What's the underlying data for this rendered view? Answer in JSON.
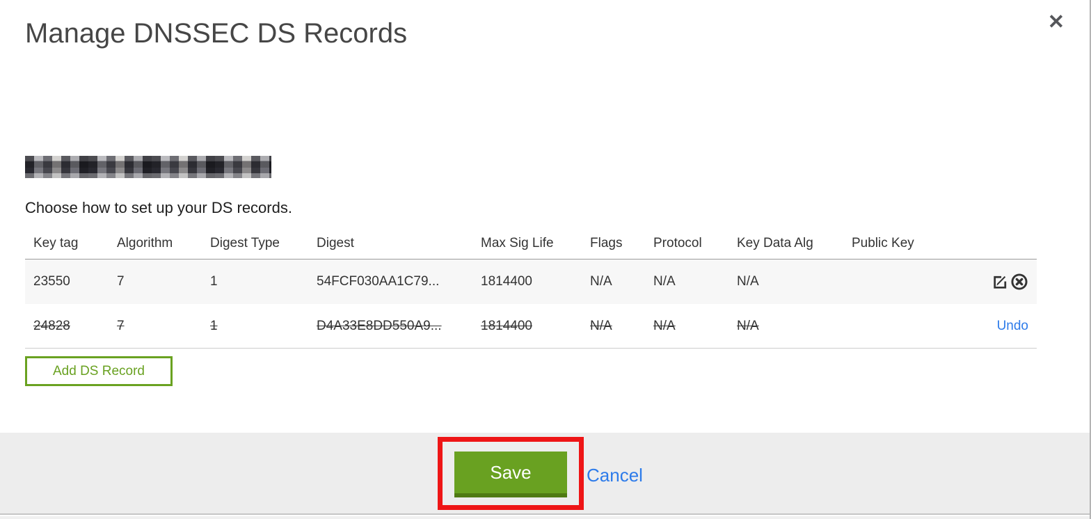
{
  "modal": {
    "title": "Manage DNSSEC DS Records"
  },
  "icons": {
    "close": "✕"
  },
  "domain": {
    "redacted": true
  },
  "instructions": "Choose how to set up your DS records.",
  "table": {
    "headers": [
      "Key tag",
      "Algorithm",
      "Digest Type",
      "Digest",
      "Max Sig Life",
      "Flags",
      "Protocol",
      "Key Data Alg",
      "Public Key"
    ],
    "rows": [
      {
        "state": "active",
        "cells": [
          "23550",
          "7",
          "1",
          "54FCF030AA1C79...",
          "1814400",
          "N/A",
          "N/A",
          "N/A",
          ""
        ]
      },
      {
        "state": "deleted",
        "cells": [
          "24828",
          "7",
          "1",
          "D4A33E8DD550A9...",
          "1814400",
          "N/A",
          "N/A",
          "N/A",
          ""
        ],
        "undo_label": "Undo"
      }
    ]
  },
  "buttons": {
    "add_ds_record": "Add DS Record",
    "save": "Save",
    "cancel": "Cancel"
  },
  "colors": {
    "accent_green": "#69a121",
    "link_blue": "#2d7bea",
    "annotation_red": "#ee1516"
  }
}
